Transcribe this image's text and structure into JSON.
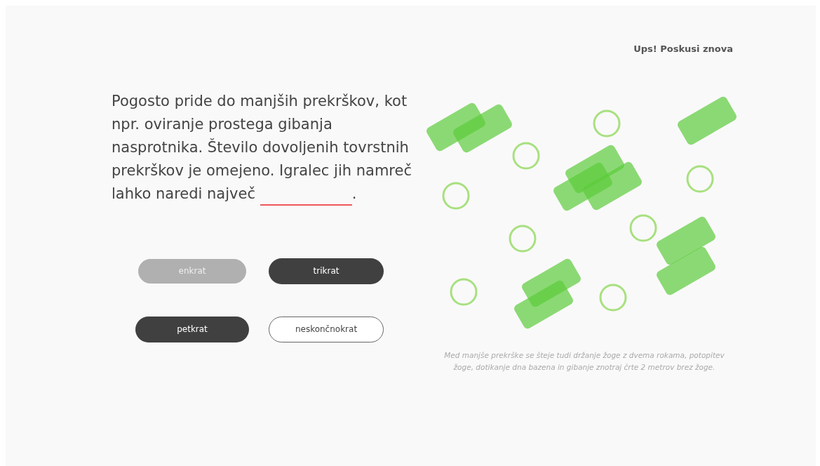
{
  "feedback": "Ups! Poskusi znova",
  "question": {
    "text": "Pogosto pride do manjših prekrškov, kot npr. oviranje prostega gibanja nasprotnika. Število dovoljenih tovrstnih prekrškov je omejeno. Igralec jih namreč lahko naredi največ",
    "after_blank": "."
  },
  "answers": [
    {
      "label": "enkrat",
      "kind": "filled",
      "disabled": true
    },
    {
      "label": "trikrat",
      "kind": "filled",
      "disabled": false
    },
    {
      "label": "petkrat",
      "kind": "filled",
      "disabled": false
    },
    {
      "label": "neskončnokrat",
      "kind": "outline",
      "disabled": false
    }
  ],
  "caption": "Med manjše prekrške se šteje tudi držanje žoge z dvema rokama, potopitev žoge, dotikanje dna bazena in gibanje znotraj črte 2 metrov brez žoge."
}
